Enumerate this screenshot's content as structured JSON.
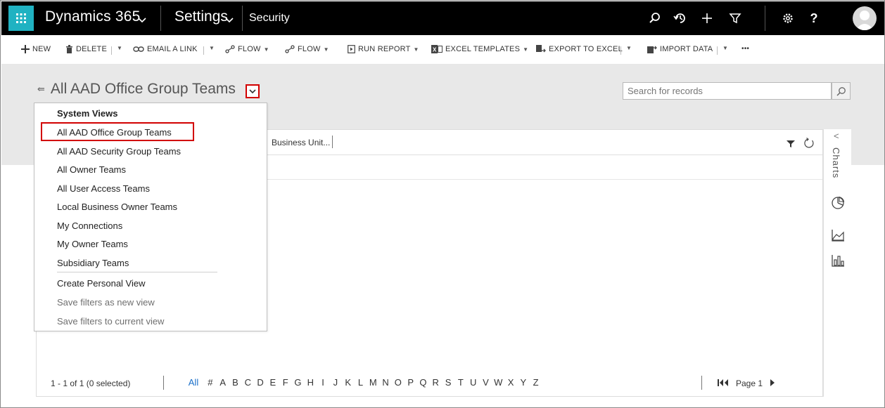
{
  "colors": {
    "nav_bg": "#000000",
    "waffle_bg": "#20b2c2",
    "highlight_red": "#d20000",
    "link_blue": "#1a6fc9",
    "band_gray": "#e8e8e8"
  },
  "nav": {
    "brand": "Dynamics 365",
    "area": "Settings",
    "page": "Security",
    "icons": [
      "waffle-icon",
      "chevron-down-icon",
      "search-icon",
      "recent-icon",
      "plus-icon",
      "filter-icon",
      "gear-icon",
      "help-icon",
      "avatar-icon"
    ],
    "help_glyph": "?"
  },
  "commands": {
    "new": "NEW",
    "delete": "DELETE",
    "email_link": "EMAIL A LINK",
    "flow_1": "FLOW",
    "flow_2": "FLOW",
    "run_report": "RUN REPORT",
    "excel_templates": "EXCEL TEMPLATES",
    "export_excel": "EXPORT TO EXCEL",
    "import_data": "IMPORT DATA",
    "more": "•••"
  },
  "view": {
    "title": "All AAD Office Group Teams",
    "search_placeholder": "Search for records"
  },
  "dropdown": {
    "heading": "System Views",
    "items": [
      "All AAD Office Group Teams",
      "All AAD Security Group Teams",
      "All Owner Teams",
      "All User Access Teams",
      "Local Business Owner Teams",
      "My Connections",
      "My Owner Teams",
      "Subsidiary Teams"
    ],
    "actions": [
      "Create Personal View",
      "Save filters as new view",
      "Save filters to current view"
    ],
    "selected_index": 0
  },
  "grid": {
    "column_business_unit": "Business Unit...",
    "status": "1 - 1 of 1 (0 selected)",
    "letters": [
      "All",
      "#",
      "A",
      "B",
      "C",
      "D",
      "E",
      "F",
      "G",
      "H",
      "I",
      "J",
      "K",
      "L",
      "M",
      "N",
      "O",
      "P",
      "Q",
      "R",
      "S",
      "T",
      "U",
      "V",
      "W",
      "X",
      "Y",
      "Z"
    ],
    "page_label": "Page 1"
  },
  "charts": {
    "label": "Charts",
    "icons": [
      "pie-chart-icon",
      "area-chart-icon",
      "bar-chart-icon"
    ]
  }
}
